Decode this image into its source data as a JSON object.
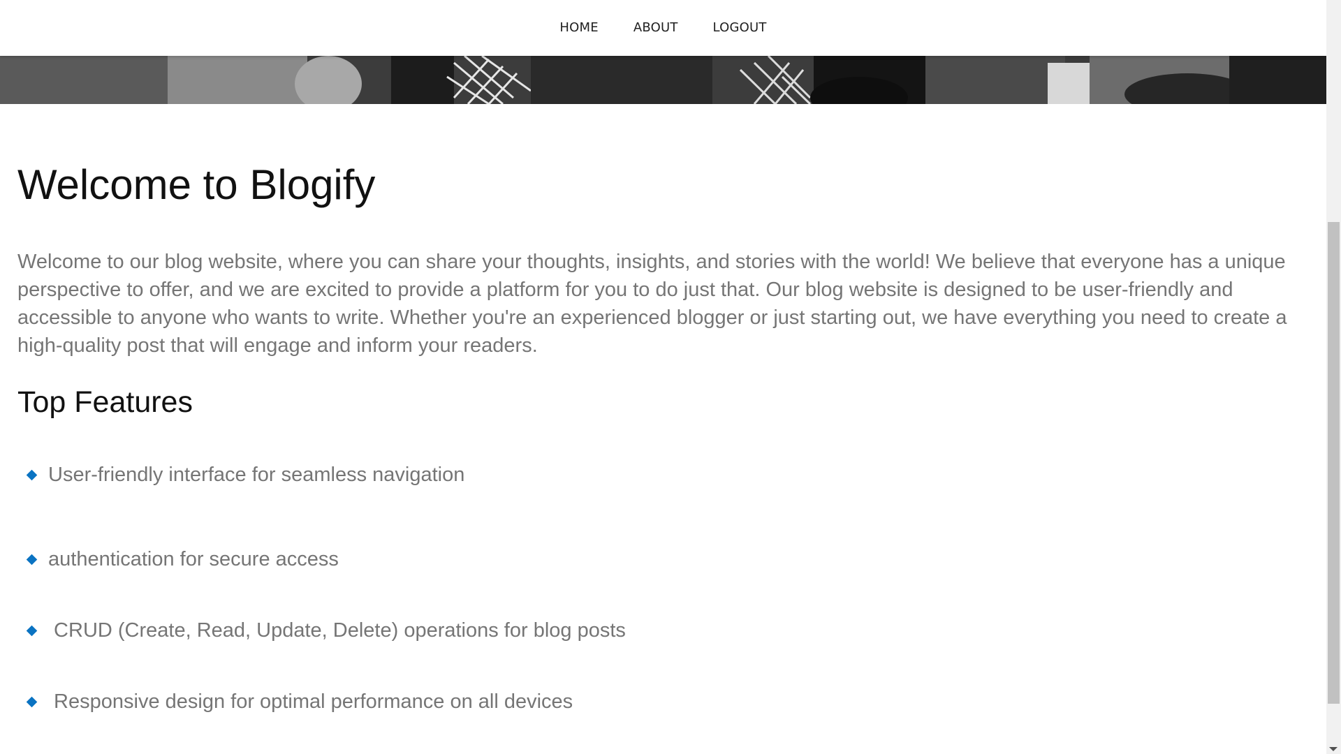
{
  "nav": {
    "home": "HOME",
    "about": "ABOUT",
    "logout": "LOGOUT"
  },
  "hero": {
    "image": "black-and-white-photo-strip"
  },
  "main": {
    "title": "Welcome to Blogify",
    "intro": "Welcome to our blog website, where you can share your thoughts, insights, and stories with the world! We believe that everyone has a unique perspective to offer, and we are excited to provide a platform for you to do just that. Our blog website is designed to be user-friendly and accessible to anyone who wants to write. Whether you're an experienced blogger or just starting out, we have everything you need to create a high-quality post that will engage and inform your readers.",
    "features_title": "Top Features",
    "features": [
      "User-friendly interface for seamless navigation",
      "authentication for secure access",
      " CRUD (Create, Read, Update, Delete) operations for blog posts",
      " Responsive design for optimal performance on all devices"
    ]
  },
  "colors": {
    "bullet": "#0a73c2",
    "body_text": "#757575",
    "heading_text": "#111111"
  }
}
